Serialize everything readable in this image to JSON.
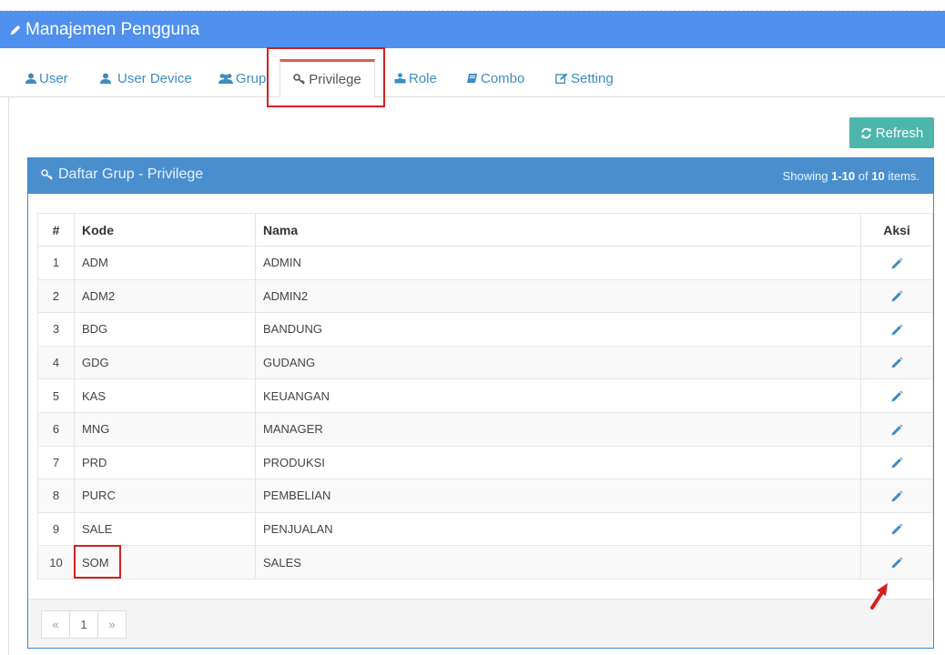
{
  "header": {
    "title": "Manajemen Pengguna",
    "icon": "pencil-icon"
  },
  "tabs": [
    {
      "label": "User",
      "icon": "user-icon"
    },
    {
      "label": "User Device",
      "icon": "user-icon"
    },
    {
      "label": "Grup",
      "icon": "users-icon"
    },
    {
      "label": "Privilege",
      "icon": "key-icon"
    },
    {
      "label": "Role",
      "icon": "sitemap-icon"
    },
    {
      "label": "Combo",
      "icon": "book-icon"
    },
    {
      "label": "Setting",
      "icon": "edit-icon"
    }
  ],
  "active_tab": "Privilege",
  "toolbar": {
    "refresh_label": "Refresh",
    "refresh_color": "#4db6ac"
  },
  "panel": {
    "title": "Daftar Grup - Privilege",
    "summary_prefix": "Showing",
    "summary_range": "1-10",
    "summary_of": "of",
    "summary_total": "10",
    "summary_suffix": "items."
  },
  "table": {
    "headers": {
      "no": "#",
      "kode": "Kode",
      "nama": "Nama",
      "aksi": "Aksi"
    },
    "rows": [
      {
        "no": "1",
        "kode": "ADM",
        "nama": "ADMIN"
      },
      {
        "no": "2",
        "kode": "ADM2",
        "nama": "ADMIN2"
      },
      {
        "no": "3",
        "kode": "BDG",
        "nama": "BANDUNG"
      },
      {
        "no": "4",
        "kode": "GDG",
        "nama": "GUDANG"
      },
      {
        "no": "5",
        "kode": "KAS",
        "nama": "KEUANGAN"
      },
      {
        "no": "6",
        "kode": "MNG",
        "nama": "MANAGER"
      },
      {
        "no": "7",
        "kode": "PRD",
        "nama": "PRODUKSI"
      },
      {
        "no": "8",
        "kode": "PURC",
        "nama": "PEMBELIAN"
      },
      {
        "no": "9",
        "kode": "SALE",
        "nama": "PENJUALAN"
      },
      {
        "no": "10",
        "kode": "SOM",
        "nama": "SALES"
      }
    ]
  },
  "pagination": {
    "prev": "«",
    "current": "1",
    "next": "»"
  },
  "colors": {
    "header": "#4f90ee",
    "panel_head": "#4a8fcd",
    "highlight": "#d42020",
    "link": "#3c8dbc"
  }
}
